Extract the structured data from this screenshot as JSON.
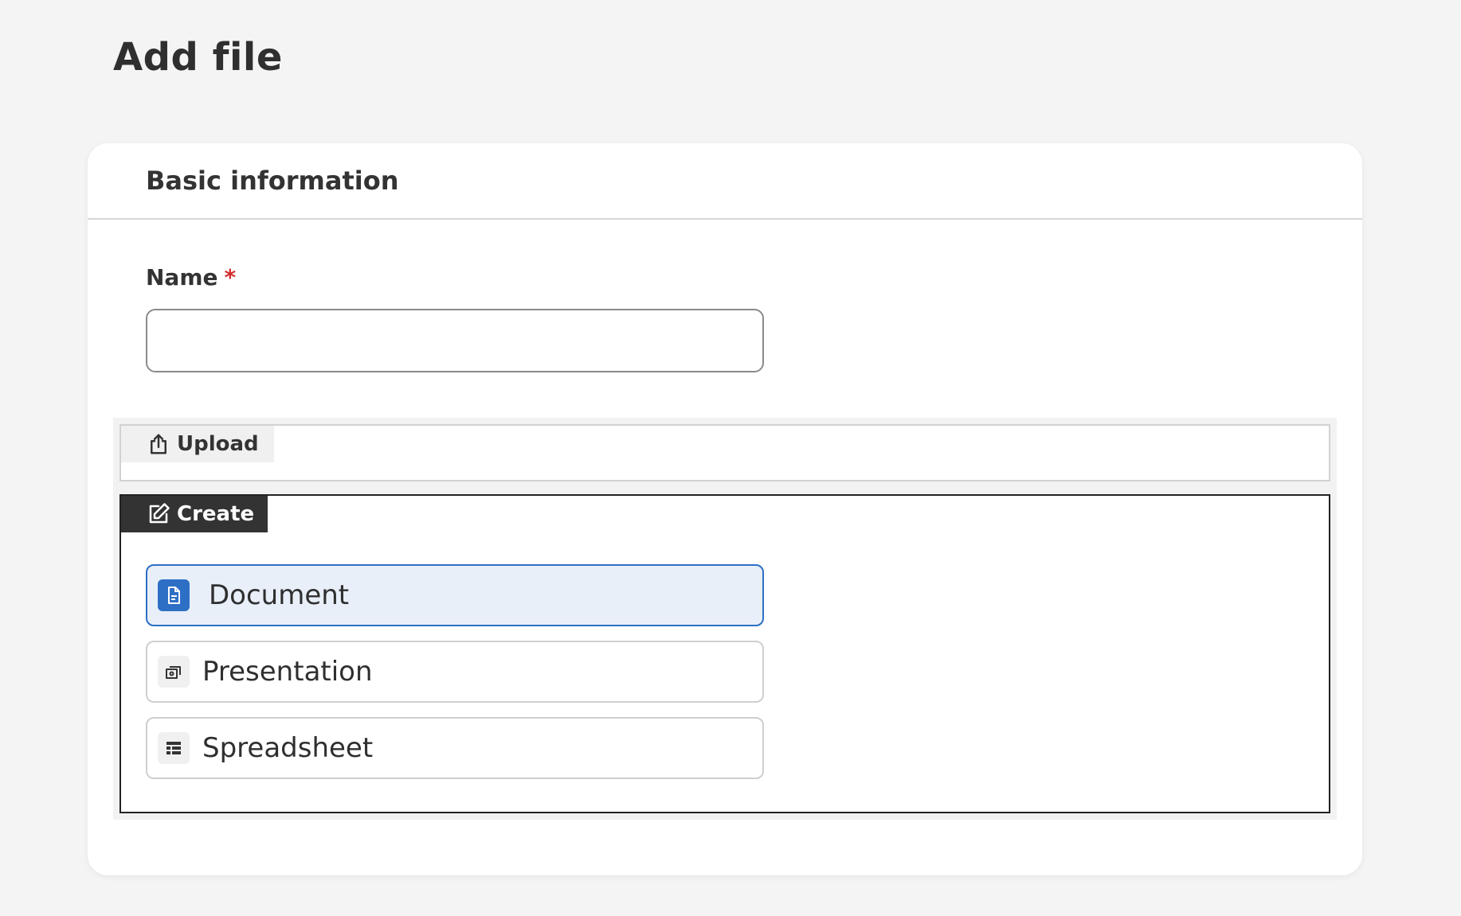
{
  "page": {
    "title": "Add file"
  },
  "card": {
    "header": "Basic information"
  },
  "name_field": {
    "label": "Name",
    "required_marker": "*",
    "value": "",
    "placeholder": ""
  },
  "tabs": {
    "upload": {
      "label": "Upload",
      "icon": "upload-icon"
    },
    "create": {
      "label": "Create",
      "icon": "edit-icon",
      "active": true
    }
  },
  "create_options": [
    {
      "label": "Document",
      "icon": "document-icon",
      "selected": true
    },
    {
      "label": "Presentation",
      "icon": "presentation-icon",
      "selected": false
    },
    {
      "label": "Spreadsheet",
      "icon": "spreadsheet-icon",
      "selected": false
    }
  ],
  "colors": {
    "accent": "#2d6fc5",
    "selected_bg": "#e8eff9",
    "required": "#d32f2f",
    "active_tab_bg": "#333333"
  }
}
